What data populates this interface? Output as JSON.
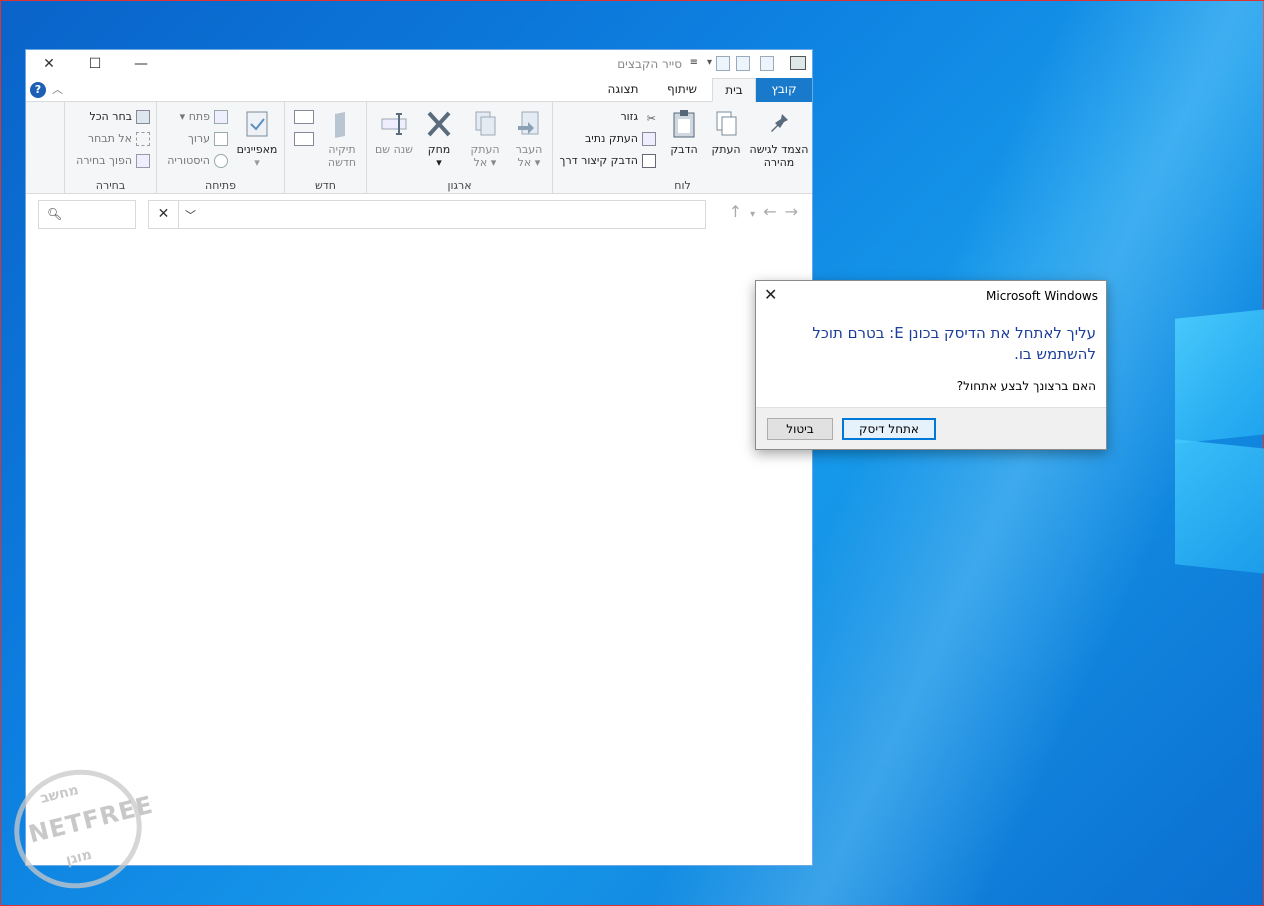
{
  "explorer": {
    "title": "סייר הקבצים",
    "controls": {
      "close": "✕",
      "maximize": "☐",
      "minimize": "—"
    },
    "tabs": {
      "file": "קובץ",
      "home": "בית",
      "share": "שיתוף",
      "view": "תצוגה"
    },
    "help": "?",
    "ribbon": {
      "clipboard": {
        "label": "לוח",
        "pin": "הצמד לגישה מהירה",
        "copy": "העתק",
        "paste": "הדבק",
        "cut": "גזור",
        "copy_path": "העתק נתיב",
        "paste_shortcut": "הדבק קיצור דרך"
      },
      "organize": {
        "label": "ארגון",
        "move_to": "העבר אל",
        "copy_to": "העתק אל",
        "delete": "מחק",
        "rename": "שנה שם"
      },
      "new": {
        "label": "חדש",
        "new_folder": "תיקיה חדשה"
      },
      "open": {
        "label": "פתיחה",
        "properties": "מאפיינים",
        "open": "פתח",
        "edit": "ערוך",
        "history": "היסטוריה"
      },
      "select": {
        "label": "בחירה",
        "select_all": "בחר הכל",
        "select_none": "אל תבחר",
        "invert": "הפוך בחירה"
      }
    }
  },
  "dialog": {
    "title": "Microsoft Windows",
    "message": "עליך לאתחל את הדיסק בכונן E: בטרם תוכל להשתמש בו.",
    "question": "האם ברצונך לבצע אתחול?",
    "format_label": "אתחל דיסק",
    "cancel_label": "ביטול"
  },
  "watermark": {
    "top": "מחשב",
    "main": "NETFREE",
    "bottom": "מוגן"
  }
}
